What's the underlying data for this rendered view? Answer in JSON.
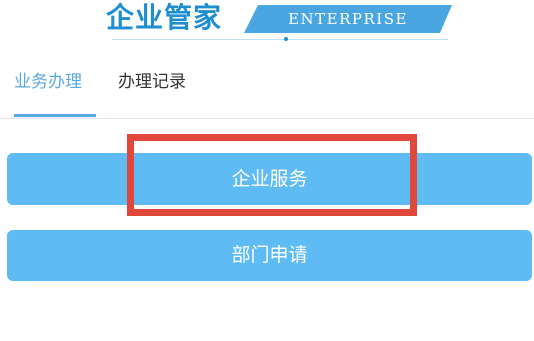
{
  "header": {
    "brand_cn": "企业管家",
    "brand_en": "ENTERPRISE"
  },
  "tabs": [
    {
      "label": "业务办理",
      "active": true
    },
    {
      "label": "办理记录",
      "active": false
    }
  ],
  "actions": [
    {
      "label": "企业服务"
    },
    {
      "label": "部门申请"
    }
  ],
  "colors": {
    "brand_blue": "#1e8ed1",
    "tab_active": "#5aa9de",
    "button_bg": "#5ebbf4",
    "highlight": "#e0483b"
  }
}
